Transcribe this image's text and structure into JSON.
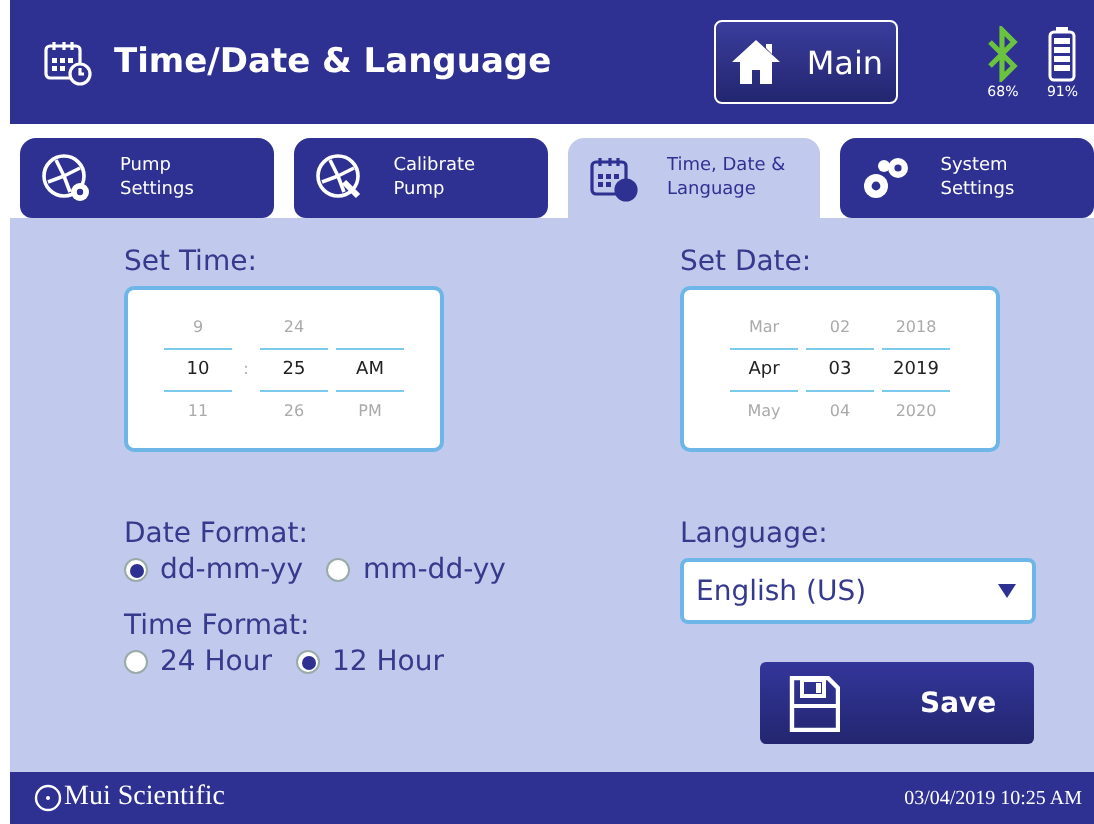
{
  "header": {
    "title": "Time/Date & Language",
    "main_button": "Main",
    "bluetooth": "68%",
    "battery": "91%"
  },
  "tabs": [
    {
      "kind": "fan",
      "line1": "Pump",
      "line2": "Settings",
      "selected": false
    },
    {
      "kind": "calibrate",
      "line1": "Calibrate",
      "line2": "Pump",
      "selected": false
    },
    {
      "kind": "calendar",
      "line1": "Time, Date &",
      "line2": "Language",
      "selected": true
    },
    {
      "kind": "gears",
      "line1": "System",
      "line2": "Settings",
      "selected": false
    }
  ],
  "set_time": {
    "label": "Set Time:",
    "separator": ":",
    "columns": [
      {
        "above": "9",
        "value": "10",
        "below": "11"
      },
      {
        "above": "24",
        "value": "25",
        "below": "26"
      },
      {
        "value": "AM",
        "below": "PM"
      }
    ]
  },
  "set_date": {
    "label": "Set Date:",
    "columns": [
      {
        "above": "Mar",
        "value": "Apr",
        "below": "May"
      },
      {
        "above": "02",
        "value": "03",
        "below": "04"
      },
      {
        "above": "2018",
        "value": "2019",
        "below": "2020"
      }
    ]
  },
  "date_format": {
    "label": "Date Format:",
    "options": [
      {
        "label": "dd-mm-yy",
        "selected": true
      },
      {
        "label": "mm-dd-yy",
        "selected": false
      }
    ]
  },
  "time_format": {
    "label": "Time Format:",
    "options": [
      {
        "label": "24 Hour",
        "selected": false
      },
      {
        "label": "12 Hour",
        "selected": true
      }
    ]
  },
  "language": {
    "label": "Language:",
    "value": "English (US)"
  },
  "save_button": "Save",
  "status_bar": {
    "brand": "Mui Scientific",
    "datetime": "03/04/2019 10:25 AM"
  }
}
